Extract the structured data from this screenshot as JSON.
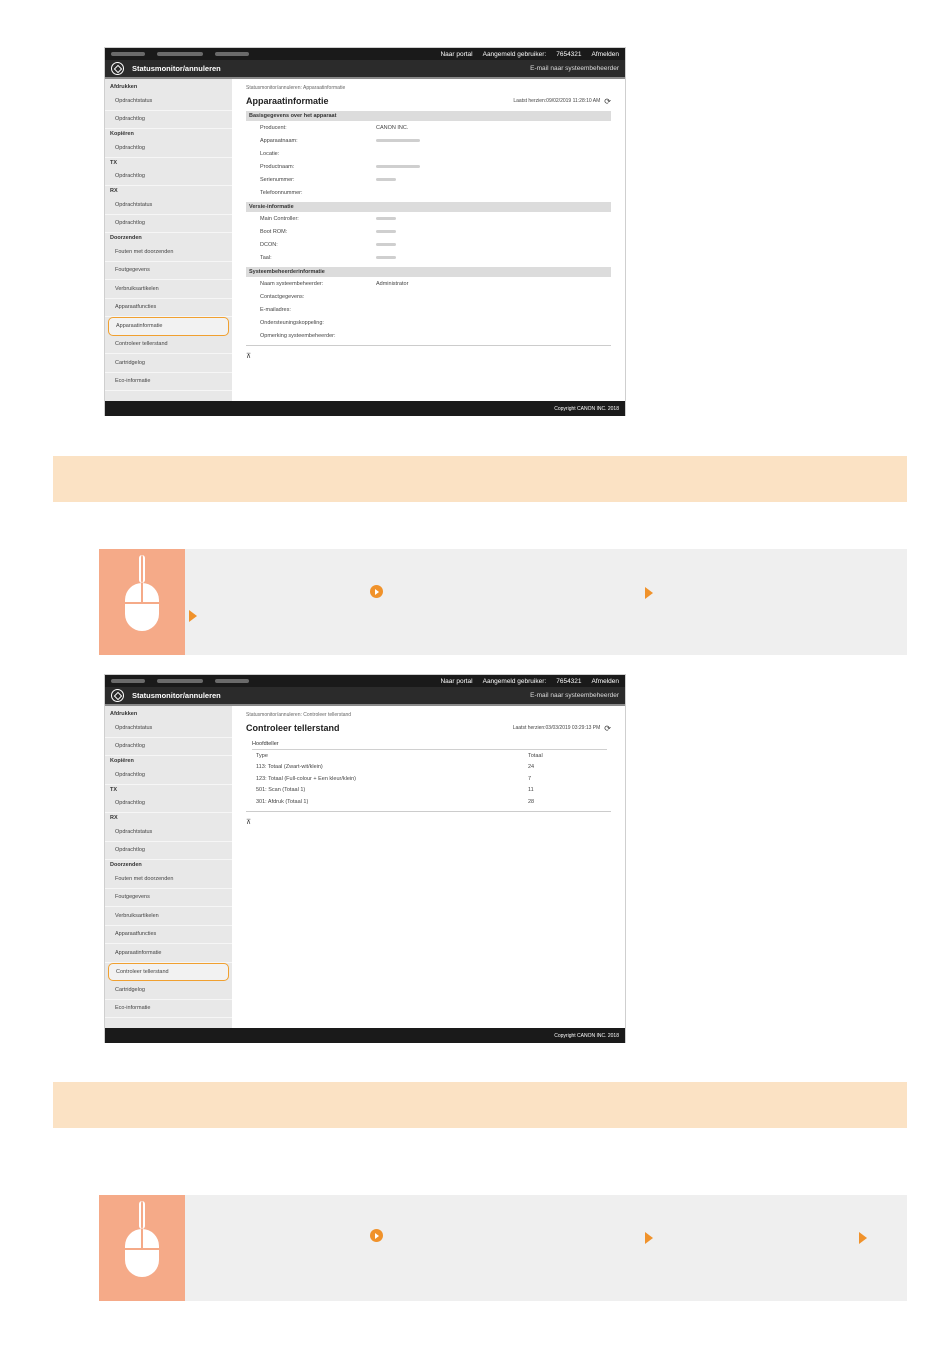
{
  "colors": {
    "accent": "#f0922b",
    "banner": "#fbe2c4",
    "mouse_tile": "#f5aa88",
    "highlight": "#f0a030"
  },
  "ui": {
    "topbar": {
      "portal": "Naar portal",
      "login_label": "Aangemeld gebruiker:",
      "login_user": "7654321",
      "logout": "Afmelden"
    },
    "header": {
      "title": "Statusmonitor/annuleren",
      "mail": "E-mail naar systeembeheerder"
    },
    "sidebar": {
      "groups": {
        "print": "Afdrukken",
        "copy": "Kopiëren",
        "tx": "TX",
        "rx": "RX",
        "device": "Doorzenden"
      },
      "items": {
        "job_status": "Opdrachtstatus",
        "job_log": "Opdrachtlog",
        "fwd_errors": "Fouten met doorzenden",
        "error_info": "Foutgegevens",
        "consumables": "Verbruiksartikelen",
        "device_features": "Apparaatfuncties",
        "device_info": "Apparaatinformatie",
        "counter": "Controleer tellerstand",
        "cartridge_log": "Cartridgelog",
        "eco": "Eco-informatie"
      }
    },
    "footer": "Copyright CANON INC. 2018",
    "toplink": "⊼"
  },
  "screen1": {
    "crumb": "Statusmonitor/annuleren: Apparaatinformatie",
    "title": "Apparaatinformatie",
    "updated": "Laatst herzien:09/02/2019 11:28:10 AM",
    "sections": {
      "basic": "Basisgegevens over het apparaat",
      "version": "Versie-informatie",
      "admin": "Systeembeheerderinformatie"
    },
    "basic_rows": {
      "manufacturer_k": "Producent:",
      "manufacturer_v": "CANON INC.",
      "device_name_k": "Apparaatnaam:",
      "location_k": "Locatie:",
      "product_name_k": "Productnaam:",
      "serial_k": "Serienummer:",
      "phone_k": "Telefoonnummer:"
    },
    "version_rows": {
      "main_k": "Main Controller:",
      "boot_k": "Boot ROM:",
      "dcon_k": "DCON:",
      "tail_k": "Taal:"
    },
    "admin_rows": {
      "name_k": "Naam systeembeheerder:",
      "name_v": "Administrator",
      "contact_k": "Contactgegevens:",
      "email_k": "E-mailadres:",
      "support_k": "Ondersteuningskoppeling:",
      "comment_k": "Opmerking systeembeheerder:"
    }
  },
  "screen2": {
    "crumb": "Statusmonitor/annuleren: Controleer tellerstand",
    "title": "Controleer tellerstand",
    "updated": "Laatst herzien:03/03/2019 03:29:13 PM",
    "subhead": "Hoofdteller",
    "col_type": "Type",
    "col_total": "Totaal",
    "rows": [
      {
        "type": "113: Totaal (Zwart-wit/klein)",
        "total": "24"
      },
      {
        "type": "123: Totaal (Full-colour + Een kleur/klein)",
        "total": "7"
      },
      {
        "type": "501: Scan (Totaal 1)",
        "total": "11"
      },
      {
        "type": "301: Afdruk (Totaal 1)",
        "total": "28"
      }
    ]
  }
}
